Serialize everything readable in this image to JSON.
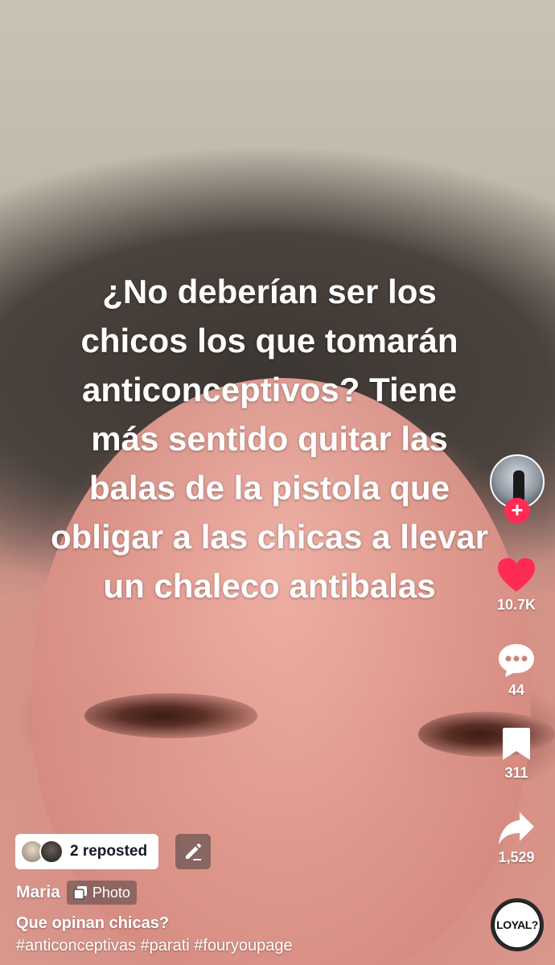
{
  "overlay": {
    "line1": "¿No deberían ser los",
    "line2": "chicos los que tomarán",
    "line3": "anticonceptivos? Tiene",
    "line4": "más sentido quitar las",
    "line5": "balas de la pistola que",
    "line6": "obligar a las chicas a llevar",
    "line7": "un chaleco antibalas"
  },
  "actions": {
    "follow_symbol": "+",
    "likes": "10.7K",
    "comments": "44",
    "saves": "311",
    "shares": "1,529"
  },
  "music": {
    "label": "LOYAL?"
  },
  "repost": {
    "label": "2 reposted"
  },
  "post": {
    "author": "Maria",
    "type_badge": "Photo",
    "caption": "Que opinan chicas?",
    "hashtags": "#anticonceptivas #parati #fouryoupage"
  },
  "colors": {
    "like_red": "#fe2c55",
    "follow_red": "#fe2c55",
    "text_white": "#ffffff",
    "pill_text": "#161823"
  },
  "icons": [
    "heart-icon",
    "comment-icon",
    "bookmark-icon",
    "share-icon",
    "pencil-icon",
    "photo-icon",
    "plus-icon"
  ]
}
